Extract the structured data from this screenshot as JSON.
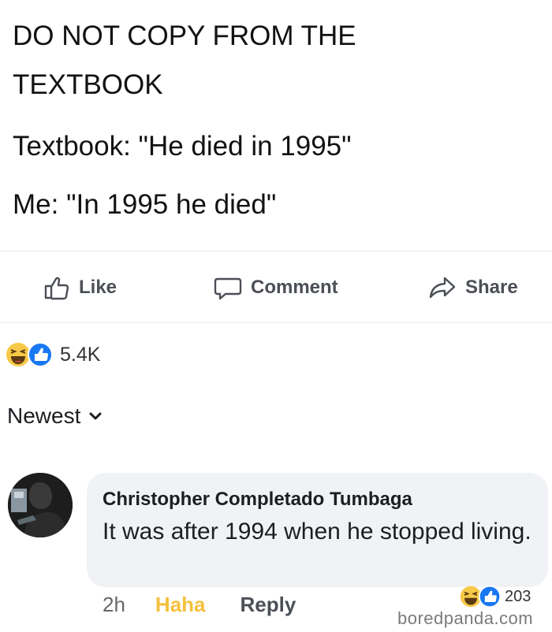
{
  "post": {
    "lines": [
      "DO NOT COPY FROM THE",
      "TEXTBOOK",
      "Textbook: \"He died in 1995\"",
      "Me: \"In 1995 he died\""
    ]
  },
  "actions": {
    "like": "Like",
    "comment": "Comment",
    "share": "Share"
  },
  "reactions": {
    "count": "5.4K",
    "icons": [
      "haha-icon",
      "like-icon"
    ]
  },
  "sort": {
    "label": "Newest"
  },
  "comment": {
    "author": "Christopher Completado Tumbaga",
    "text": "It was after 1994 when he stopped living.",
    "time": "2h",
    "haha_label": "Haha",
    "reply_label": "Reply",
    "reaction_count": "203"
  },
  "watermark": "boredpanda.com",
  "colors": {
    "action_text": "#4b4f56",
    "haha": "#f5c03b",
    "like_blue": "#1877f2",
    "bubble_bg": "#f0f2f5"
  }
}
